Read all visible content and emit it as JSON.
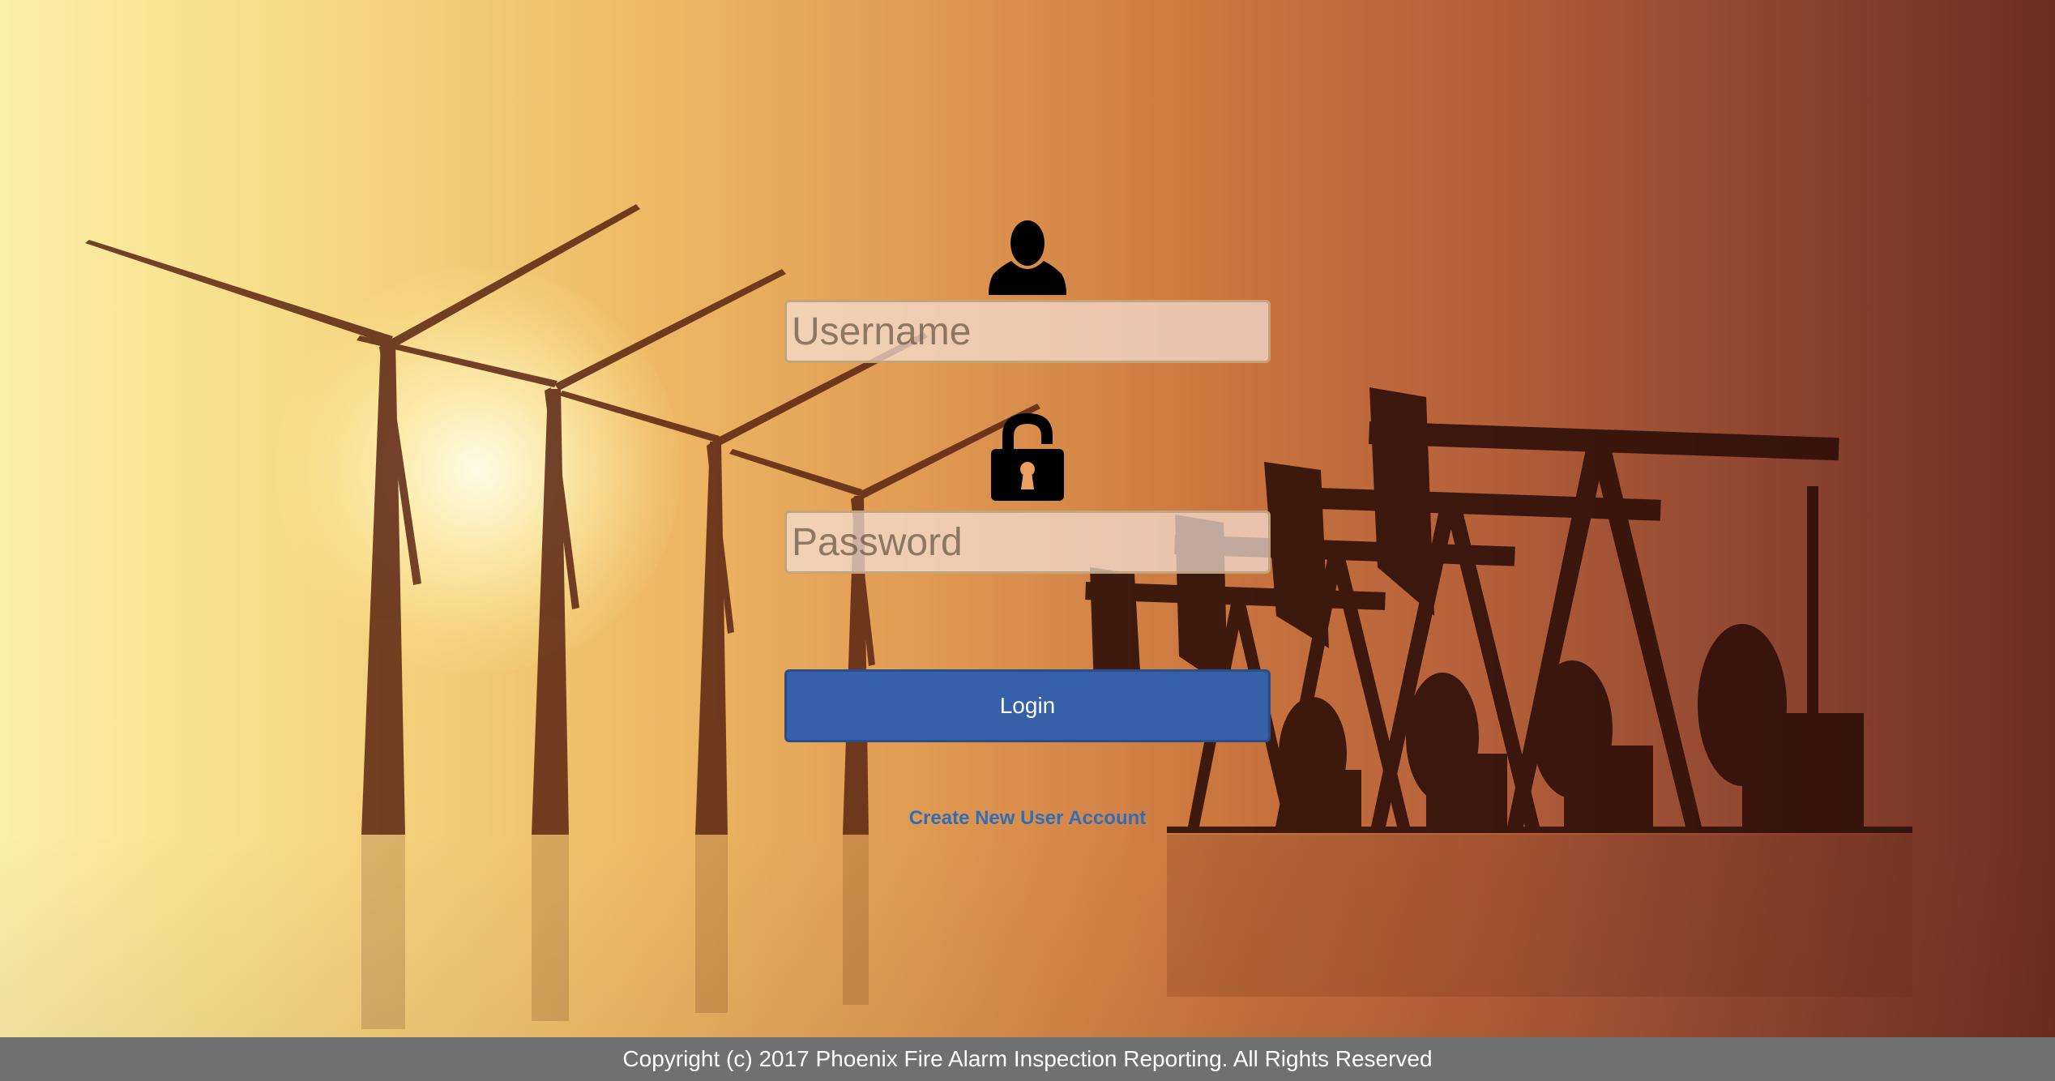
{
  "login": {
    "user_icon": "user-silhouette-icon",
    "username_placeholder": "Username",
    "username_value": "",
    "lock_icon": "padlock-icon",
    "password_placeholder": "Password",
    "password_value": "",
    "login_label": "Login",
    "create_account_label": "Create New User Account"
  },
  "footer": {
    "copyright": "Copyright (c) 2017 Phoenix Fire Alarm Inspection Reporting. All Rights Reserved"
  },
  "background": {
    "scene": "wind-turbines-and-oil-pumpjacks-silhouette",
    "colors": {
      "sky_left": "#fbf0a8",
      "sky_mid": "#e09a52",
      "sky_right": "#6b2e22",
      "silhouette": "#3a140a"
    }
  },
  "colors": {
    "login_button": "#3660a8",
    "link": "#2f6db8",
    "footer_bg": "#707070"
  }
}
